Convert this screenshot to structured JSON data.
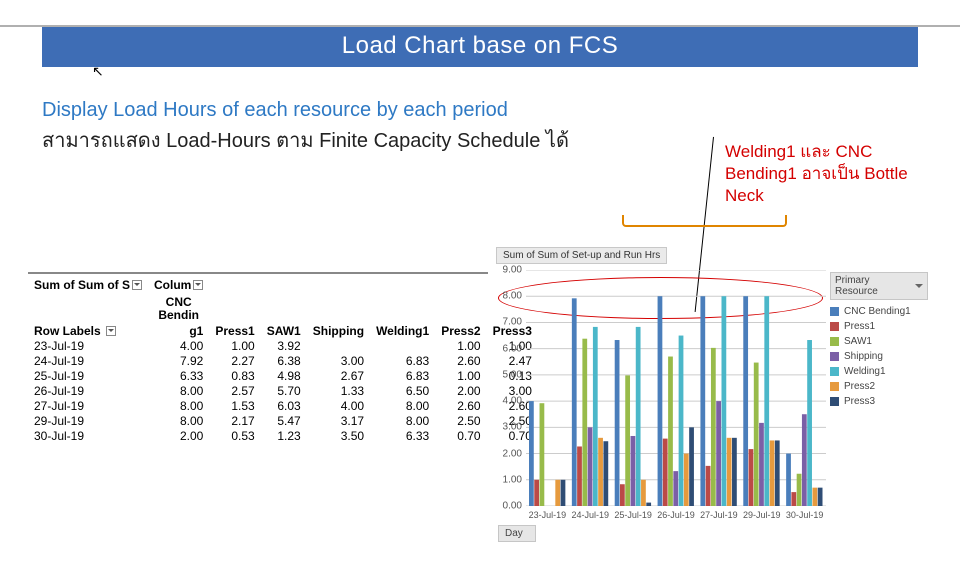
{
  "title": "Load Chart base on FCS",
  "subhead_en": "Display Load Hours of each resource by each period",
  "subhead_th": "สามารถแสดง Load-Hours  ตาม  Finite Capacity Schedule ได้",
  "annotation": "Welding1 และ CNC Bending1  อาจเป็น Bottle Neck",
  "pivot": {
    "measure_label": "Sum of Sum of S",
    "column_label": "Colum",
    "row_label": "Row Labels",
    "columns": [
      "CNC Bending1",
      "Press1",
      "SAW1",
      "Shipping",
      "Welding1",
      "Press2",
      "Press3"
    ]
  },
  "table_rows": [
    {
      "date": "23-Jul-19",
      "CNC Bending1": 4.0,
      "Press1": 1.0,
      "SAW1": 3.92,
      "Shipping": null,
      "Welding1": null,
      "Press2": 1.0,
      "Press3": 1.0
    },
    {
      "date": "24-Jul-19",
      "CNC Bending1": 7.92,
      "Press1": 2.27,
      "SAW1": 6.38,
      "Shipping": 3.0,
      "Welding1": 6.83,
      "Press2": 2.6,
      "Press3": 2.47
    },
    {
      "date": "25-Jul-19",
      "CNC Bending1": 6.33,
      "Press1": 0.83,
      "SAW1": 4.98,
      "Shipping": 2.67,
      "Welding1": 6.83,
      "Press2": 1.0,
      "Press3": 0.13
    },
    {
      "date": "26-Jul-19",
      "CNC Bending1": 8.0,
      "Press1": 2.57,
      "SAW1": 5.7,
      "Shipping": 1.33,
      "Welding1": 6.5,
      "Press2": 2.0,
      "Press3": 3.0
    },
    {
      "date": "27-Jul-19",
      "CNC Bending1": 8.0,
      "Press1": 1.53,
      "SAW1": 6.03,
      "Shipping": 4.0,
      "Welding1": 8.0,
      "Press2": 2.6,
      "Press3": 2.6
    },
    {
      "date": "29-Jul-19",
      "CNC Bending1": 8.0,
      "Press1": 2.17,
      "SAW1": 5.47,
      "Shipping": 3.17,
      "Welding1": 8.0,
      "Press2": 2.5,
      "Press3": 2.5
    },
    {
      "date": "30-Jul-19",
      "CNC Bending1": 2.0,
      "Press1": 0.53,
      "SAW1": 1.23,
      "Shipping": 3.5,
      "Welding1": 6.33,
      "Press2": 0.7,
      "Press3": 0.7
    }
  ],
  "chart_title": "Sum of Sum of Set-up and Run Hrs",
  "legend_title": "Primary Resource",
  "day_label": "Day",
  "series_colors": {
    "CNC Bending1": "#4a7ebb",
    "Press1": "#bb4a47",
    "SAW1": "#98bb4a",
    "Shipping": "#7b5fa6",
    "Welding1": "#4bb7c9",
    "Press2": "#e69a3e",
    "Press3": "#2f4d75"
  },
  "chart_data": {
    "type": "bar",
    "title": "Sum of Sum of Set-up and Run Hrs",
    "xlabel": "Day",
    "ylabel": "",
    "ylim": [
      0,
      9
    ],
    "yticks": [
      0,
      1,
      2,
      3,
      4,
      5,
      6,
      7,
      8,
      9
    ],
    "categories": [
      "23-Jul-19",
      "24-Jul-19",
      "25-Jul-19",
      "26-Jul-19",
      "27-Jul-19",
      "29-Jul-19",
      "30-Jul-19"
    ],
    "series": [
      {
        "name": "CNC Bending1",
        "values": [
          4.0,
          7.92,
          6.33,
          8.0,
          8.0,
          8.0,
          2.0
        ]
      },
      {
        "name": "Press1",
        "values": [
          1.0,
          2.27,
          0.83,
          2.57,
          1.53,
          2.17,
          0.53
        ]
      },
      {
        "name": "SAW1",
        "values": [
          3.92,
          6.38,
          4.98,
          5.7,
          6.03,
          5.47,
          1.23
        ]
      },
      {
        "name": "Shipping",
        "values": [
          null,
          3.0,
          2.67,
          1.33,
          4.0,
          3.17,
          3.5
        ]
      },
      {
        "name": "Welding1",
        "values": [
          null,
          6.83,
          6.83,
          6.5,
          8.0,
          8.0,
          6.33
        ]
      },
      {
        "name": "Press2",
        "values": [
          1.0,
          2.6,
          1.0,
          2.0,
          2.6,
          2.5,
          0.7
        ]
      },
      {
        "name": "Press3",
        "values": [
          1.0,
          2.47,
          0.13,
          3.0,
          2.6,
          2.5,
          0.7
        ]
      }
    ],
    "legend_position": "right",
    "grid": true
  }
}
